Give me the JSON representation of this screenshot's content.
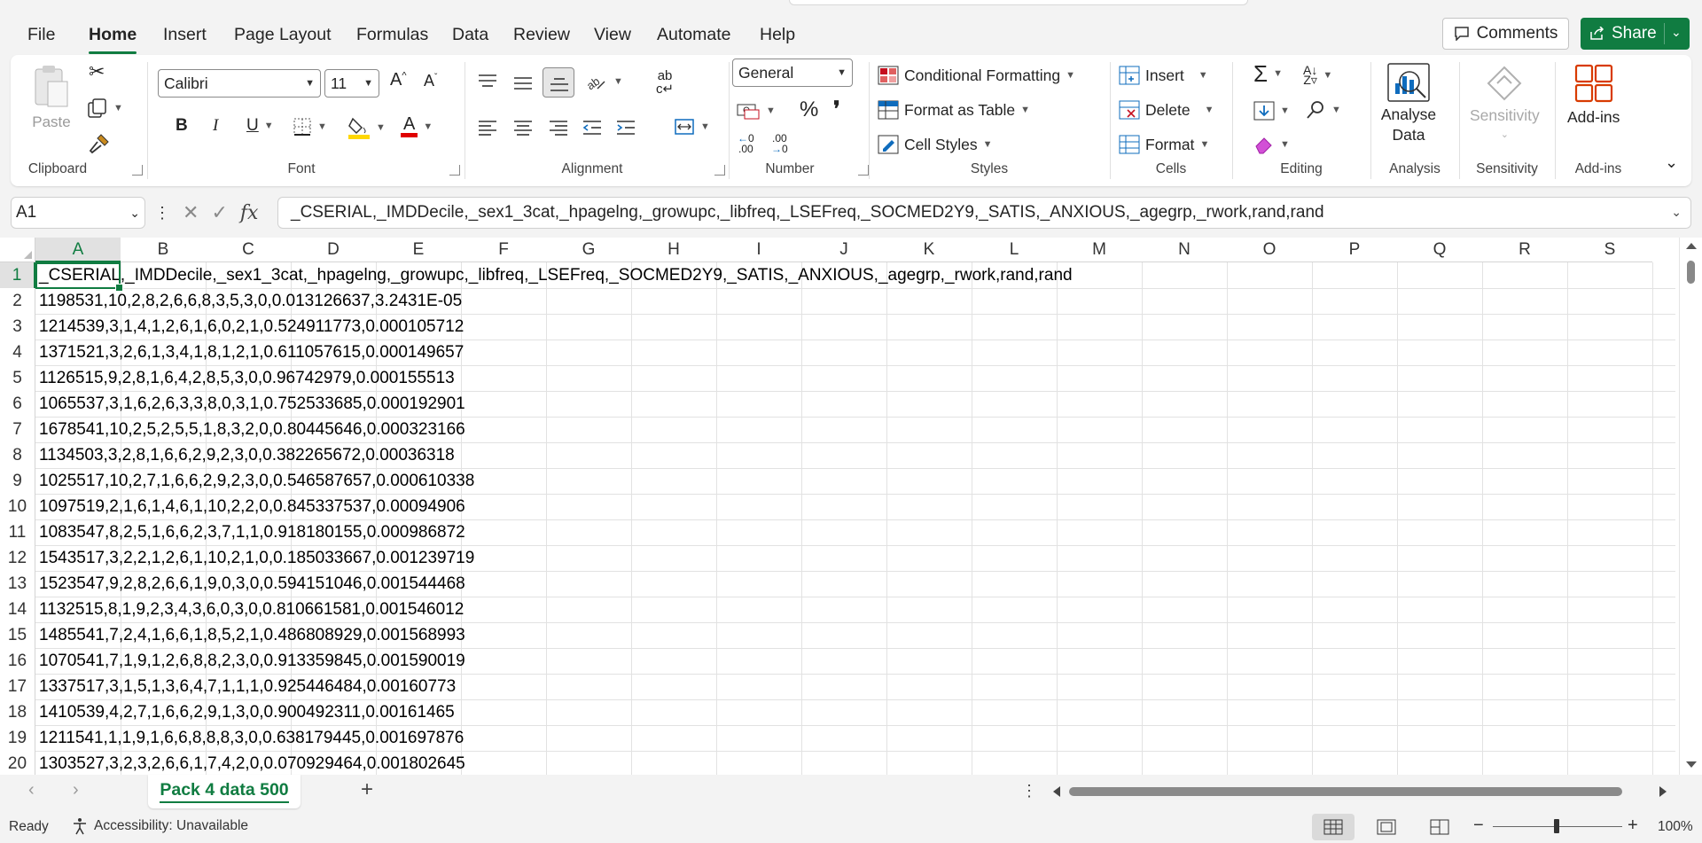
{
  "menu": {
    "tabs": [
      "File",
      "Home",
      "Insert",
      "Page Layout",
      "Formulas",
      "Data",
      "Review",
      "View",
      "Automate",
      "Help"
    ],
    "active": "Home",
    "comments_label": "Comments",
    "share_label": "Share"
  },
  "ribbon": {
    "clipboard": {
      "label": "Clipboard",
      "paste": "Paste"
    },
    "font": {
      "label": "Font",
      "family": "Calibri",
      "size": "11"
    },
    "alignment": {
      "label": "Alignment"
    },
    "number": {
      "label": "Number",
      "format": "General"
    },
    "styles": {
      "label": "Styles",
      "conditional": "Conditional Formatting",
      "format_table": "Format as Table",
      "cell_styles": "Cell Styles"
    },
    "cells": {
      "label": "Cells",
      "insert": "Insert",
      "delete": "Delete",
      "format": "Format"
    },
    "editing": {
      "label": "Editing"
    },
    "analysis": {
      "label": "Analysis",
      "analyse_data": "Analyse Data"
    },
    "sensitivity": {
      "label": "Sensitivity",
      "button": "Sensitivity"
    },
    "addins": {
      "label": "Add-ins",
      "button": "Add-ins"
    }
  },
  "formula_bar": {
    "name_box": "A1",
    "fx": "fx",
    "content": "_CSERIAL,_IMDDecile,_sex1_3cat,_hpagelng,_growupc,_libfreq,_LSEFreq,_SOCMED2Y9,_SATIS,_ANXIOUS,_agegrp,_rwork,rand,rand"
  },
  "grid": {
    "columns": [
      "A",
      "B",
      "C",
      "D",
      "E",
      "F",
      "G",
      "H",
      "I",
      "J",
      "K",
      "L",
      "M",
      "N",
      "O",
      "P",
      "Q",
      "R",
      "S"
    ],
    "rows": [
      {
        "n": "1",
        "a": "_CSERIAL,_IMDDecile,_sex1_3cat,_hpagelng,_growupc,_libfreq,_LSEFreq,_SOCMED2Y9,_SATIS,_ANXIOUS,_agegrp,_rwork,rand,rand"
      },
      {
        "n": "2",
        "a": "1198531,10,2,8,2,6,6,8,3,5,3,0,0.013126637,3.2431E-05"
      },
      {
        "n": "3",
        "a": "1214539,3,1,4,1,2,6,1,6,0,2,1,0.524911773,0.000105712"
      },
      {
        "n": "4",
        "a": "1371521,3,2,6,1,3,4,1,8,1,2,1,0.611057615,0.000149657"
      },
      {
        "n": "5",
        "a": "1126515,9,2,8,1,6,4,2,8,5,3,0,0.96742979,0.000155513"
      },
      {
        "n": "6",
        "a": "1065537,3,1,6,2,6,3,3,8,0,3,1,0.752533685,0.000192901"
      },
      {
        "n": "7",
        "a": "1678541,10,2,5,2,5,5,1,8,3,2,0,0.80445646,0.000323166"
      },
      {
        "n": "8",
        "a": "1134503,3,2,8,1,6,6,2,9,2,3,0,0.382265672,0.00036318"
      },
      {
        "n": "9",
        "a": "1025517,10,2,7,1,6,6,2,9,2,3,0,0.546587657,0.000610338"
      },
      {
        "n": "10",
        "a": "1097519,2,1,6,1,4,6,1,10,2,2,0,0.845337537,0.00094906"
      },
      {
        "n": "11",
        "a": "1083547,8,2,5,1,6,6,2,3,7,1,1,0.918180155,0.000986872"
      },
      {
        "n": "12",
        "a": "1543517,3,2,2,1,2,6,1,10,2,1,0,0.185033667,0.001239719"
      },
      {
        "n": "13",
        "a": "1523547,9,2,8,2,6,6,1,9,0,3,0,0.594151046,0.001544468"
      },
      {
        "n": "14",
        "a": "1132515,8,1,9,2,3,4,3,6,0,3,0,0.810661581,0.001546012"
      },
      {
        "n": "15",
        "a": "1485541,7,2,4,1,6,6,1,8,5,2,1,0.486808929,0.001568993"
      },
      {
        "n": "16",
        "a": "1070541,7,1,9,1,2,6,8,8,2,3,0,0.913359845,0.001590019"
      },
      {
        "n": "17",
        "a": "1337517,3,1,5,1,3,6,4,7,1,1,1,0.925446484,0.00160773"
      },
      {
        "n": "18",
        "a": "1410539,4,2,7,1,6,6,2,9,1,3,0,0.900492311,0.00161465"
      },
      {
        "n": "19",
        "a": "1211541,1,1,9,1,6,6,8,8,8,3,0,0.638179445,0.001697876"
      },
      {
        "n": "20",
        "a": "1303527,3,2,3,2,6,6,1,7,4,2,0,0.070929464,0.001802645"
      }
    ]
  },
  "sheets": {
    "active": "Pack 4 data 500",
    "add": "+"
  },
  "status": {
    "ready": "Ready",
    "accessibility": "Accessibility: Unavailable",
    "zoom": "100%"
  },
  "colors": {
    "accent": "#107c41"
  }
}
